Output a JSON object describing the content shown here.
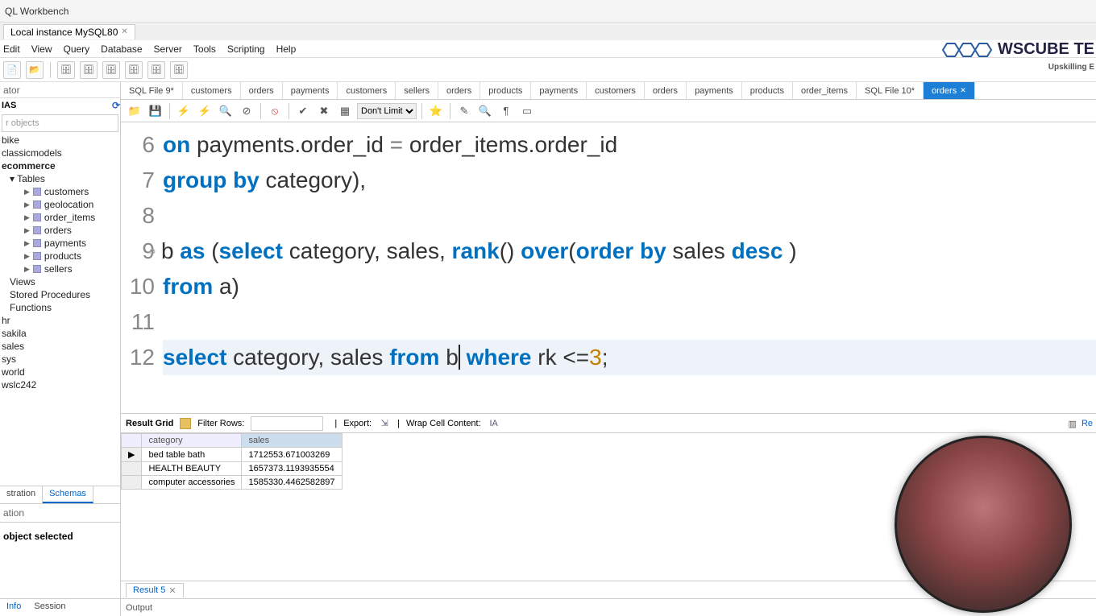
{
  "title": "QL Workbench",
  "conn_tab": "Local instance MySQL80",
  "menus": [
    "Edit",
    "View",
    "Query",
    "Database",
    "Server",
    "Tools",
    "Scripting",
    "Help"
  ],
  "logo": {
    "name": "WSCUBE TE",
    "tag": "Upskilling E"
  },
  "sidebar": {
    "panel": "ator",
    "section": "IAS",
    "filter_placeholder": "r objects",
    "schemas": [
      "bike",
      "classicmodels"
    ],
    "ecommerce": "ecommerce",
    "tables_label": "Tables",
    "tables": [
      "customers",
      "geolocation",
      "order_items",
      "orders",
      "payments",
      "products",
      "sellers"
    ],
    "groups": [
      "Views",
      "Stored Procedures",
      "Functions"
    ],
    "others": [
      "hr",
      "sakila",
      "sales",
      "sys",
      "world",
      "wslc242"
    ],
    "btabs": [
      "stration",
      "Schemas"
    ],
    "sec2": "ation",
    "sec3": "object selected",
    "btabs2": [
      "Info",
      "Session"
    ]
  },
  "filetabs": [
    "SQL File 9*",
    "customers",
    "orders",
    "payments",
    "customers",
    "sellers",
    "orders",
    "products",
    "payments",
    "customers",
    "orders",
    "payments",
    "products",
    "order_items",
    "SQL File 10*",
    "orders"
  ],
  "active_filetab": 15,
  "limit": "Don't Limit",
  "code": {
    "lines": [
      6,
      7,
      8,
      9,
      10,
      11,
      12
    ]
  },
  "sql_tokens": {
    "l6": [
      {
        "t": "on",
        "c": "kw"
      },
      {
        "t": " payments.order_id ",
        "c": "id"
      },
      {
        "t": "=",
        "c": "op"
      },
      {
        "t": " order_items.order_id",
        "c": "id"
      }
    ],
    "l7": [
      {
        "t": "group by",
        "c": "kw"
      },
      {
        "t": " category),",
        "c": "id"
      }
    ],
    "l8": [],
    "l9": [
      {
        "t": "b ",
        "c": "id"
      },
      {
        "t": "as",
        "c": "kw"
      },
      {
        "t": " (",
        "c": "id"
      },
      {
        "t": "select",
        "c": "kw"
      },
      {
        "t": " category, sales, ",
        "c": "id"
      },
      {
        "t": "rank",
        "c": "fn"
      },
      {
        "t": "() ",
        "c": "id"
      },
      {
        "t": "over",
        "c": "kw"
      },
      {
        "t": "(",
        "c": "id"
      },
      {
        "t": "order by",
        "c": "kw"
      },
      {
        "t": " sales ",
        "c": "id"
      },
      {
        "t": "desc",
        "c": "kw"
      },
      {
        "t": " )",
        "c": "id"
      }
    ],
    "l10": [
      {
        "t": "from",
        "c": "kw"
      },
      {
        "t": " a)",
        "c": "id"
      }
    ],
    "l11": [],
    "l12": [
      {
        "t": "select",
        "c": "kw"
      },
      {
        "t": " category, sales ",
        "c": "id"
      },
      {
        "t": "from",
        "c": "kw"
      },
      {
        "t": " b",
        "c": "id"
      },
      {
        "t": "",
        "c": "cur"
      },
      {
        "t": " ",
        "c": "id"
      },
      {
        "t": "where",
        "c": "kw"
      },
      {
        "t": " rk <=",
        "c": "id"
      },
      {
        "t": "3",
        "c": "num"
      },
      {
        "t": ";",
        "c": "id"
      }
    ]
  },
  "reshdr": {
    "grid": "Result Grid",
    "filter": "Filter Rows:",
    "export": "Export:",
    "wrap": "Wrap Cell Content:"
  },
  "grid": {
    "cols": [
      "category",
      "sales"
    ],
    "selcol": 1,
    "rows": [
      [
        "bed table bath",
        "1712553.671003269"
      ],
      [
        "HEALTH BEAUTY",
        "1657373.1193935554"
      ],
      [
        "computer accessories",
        "1585330.4462582897"
      ]
    ]
  },
  "result_tab": "Result 5",
  "output": "Output",
  "right_re": "Re"
}
